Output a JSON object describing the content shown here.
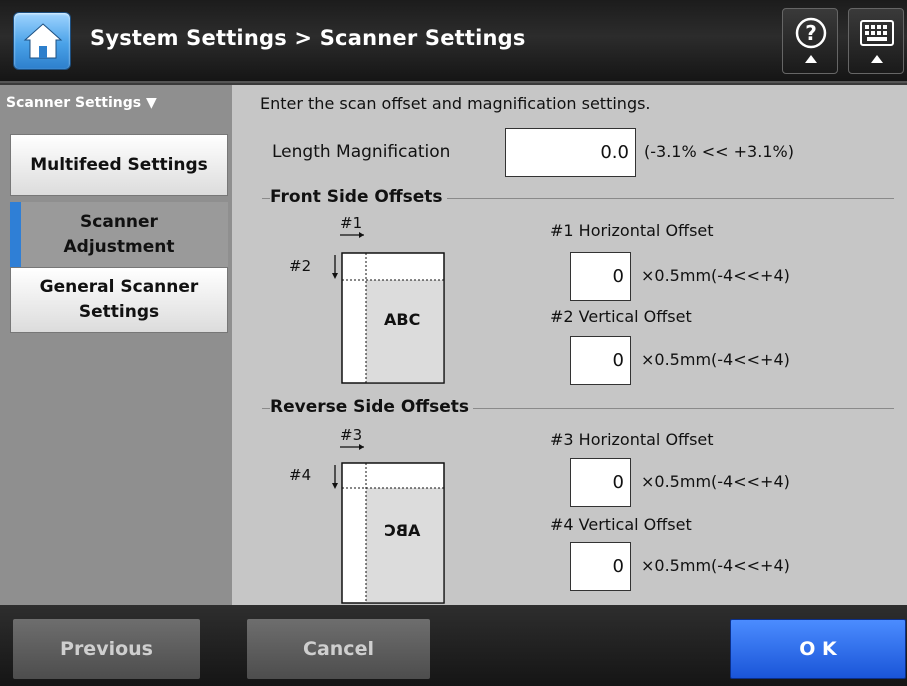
{
  "header": {
    "title": "System Settings > Scanner Settings",
    "icons": [
      "home-icon",
      "help-icon",
      "keyboard-icon"
    ]
  },
  "sidebar": {
    "heading": "Scanner Settings ▼",
    "items": [
      {
        "label": "Multifeed Settings",
        "active": false
      },
      {
        "label": "Scanner Adjustment",
        "active": true
      },
      {
        "label": "General Scanner Settings",
        "active": false
      }
    ]
  },
  "main": {
    "instruction": "Enter the scan offset and magnification settings.",
    "length_magnification": {
      "label": "Length Magnification",
      "value": "0.0",
      "range": "(-3.1% << +3.1%)"
    },
    "front": {
      "title": "Front Side Offsets",
      "mark_h": "#1",
      "mark_v": "#2",
      "sample_text": "ABC",
      "horizontal": {
        "label": "#1 Horizontal Offset",
        "value": "0",
        "unit": "×0.5mm(-4<<+4)"
      },
      "vertical": {
        "label": "#2 Vertical Offset",
        "value": "0",
        "unit": "×0.5mm(-4<<+4)"
      }
    },
    "reverse": {
      "title": "Reverse Side Offsets",
      "mark_h": "#3",
      "mark_v": "#4",
      "sample_text": "ABC",
      "horizontal": {
        "label": "#3 Horizontal Offset",
        "value": "0",
        "unit": "×0.5mm(-4<<+4)"
      },
      "vertical": {
        "label": "#4 Vertical Offset",
        "value": "0",
        "unit": "×0.5mm(-4<<+4)"
      }
    }
  },
  "footer": {
    "previous": "Previous",
    "cancel": "Cancel",
    "ok": "O K"
  },
  "colors": {
    "accent": "#2f7fd6",
    "ok_button": "#1a55d8"
  }
}
